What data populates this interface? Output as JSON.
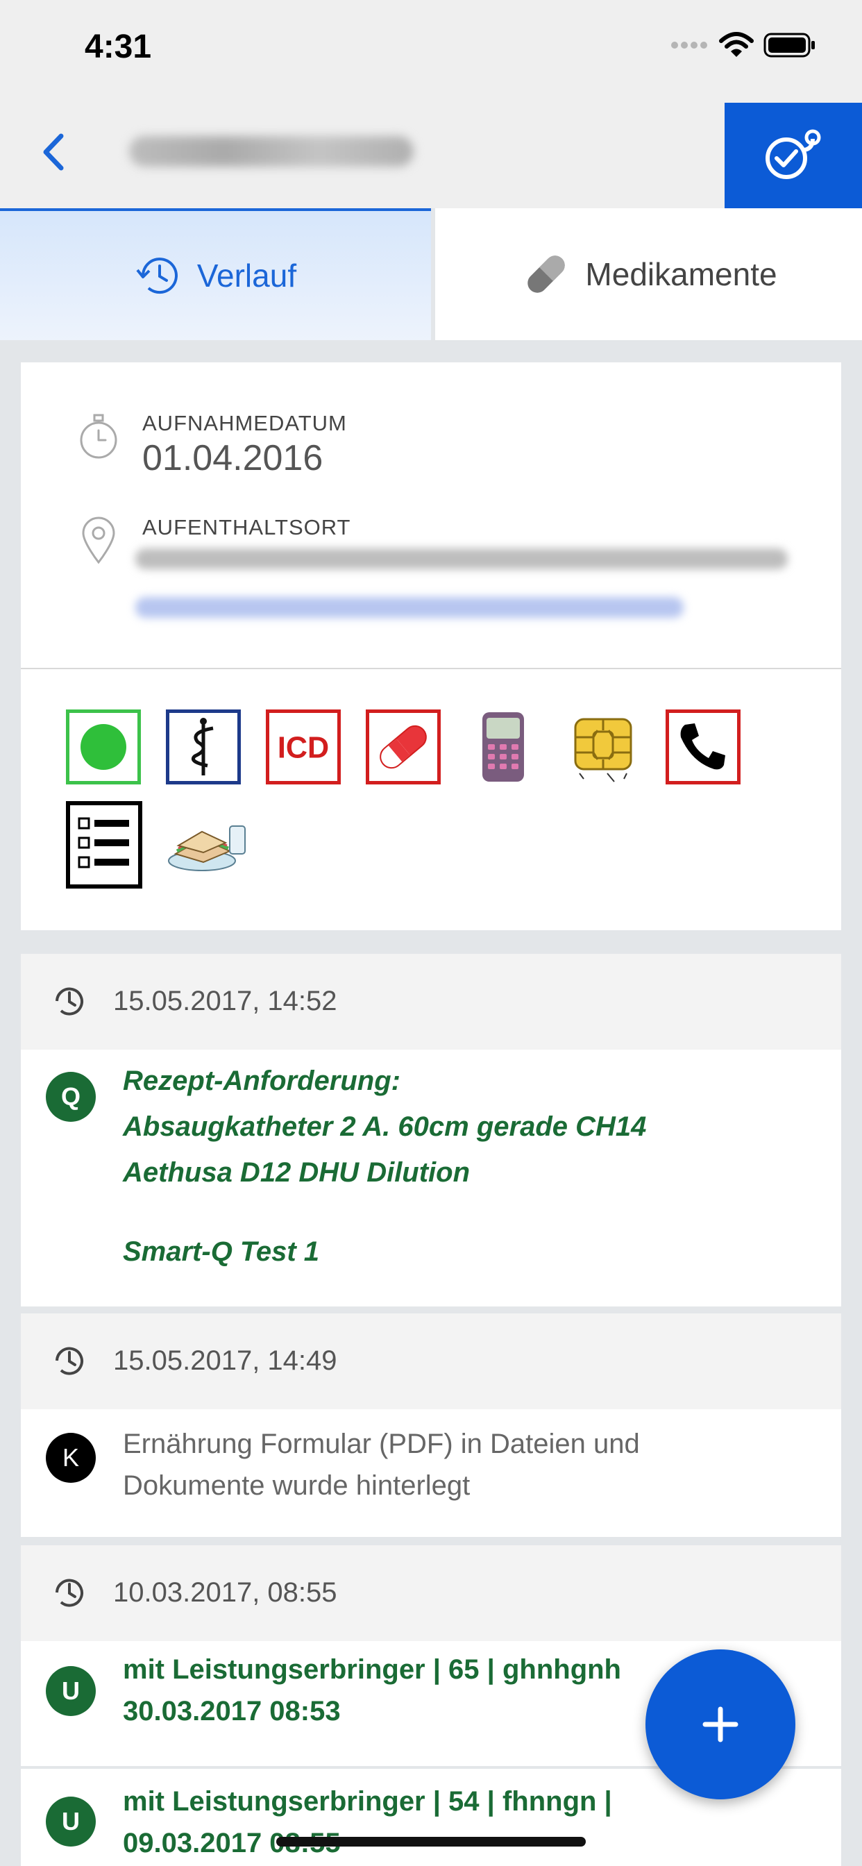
{
  "status_bar": {
    "time": "4:31"
  },
  "tabs": [
    {
      "label": "Verlauf",
      "icon": "history-icon",
      "active": true
    },
    {
      "label": "Medikamente",
      "icon": "pill-icon",
      "active": false
    }
  ],
  "info": {
    "admission_label": "AUFNAHMEDATUM",
    "admission_date": "01.04.2016",
    "location_label": "AUFENTHALTSORT"
  },
  "quick_icons": [
    "status-green-icon",
    "medical-caduceus-icon",
    "icd-icon",
    "medication-pill-icon",
    "infusion-pump-icon",
    "chip-card-icon",
    "phone-icon",
    "checklist-icon",
    "meal-icon"
  ],
  "timeline": [
    {
      "timestamp": "15.05.2017, 14:52",
      "entries": [
        {
          "badge": "Q",
          "badge_color": "#1a6b35",
          "lines": [
            "Rezept-Anforderung:",
            "Absaugkatheter 2 A. 60cm gerade CH14",
            "Aethusa D12 DHU Dilution",
            "Smart-Q Test 1"
          ]
        }
      ]
    },
    {
      "timestamp": "15.05.2017, 14:49",
      "entries": [
        {
          "badge": "K",
          "badge_color": "#000000",
          "lines": [
            "Ernährung Formular (PDF) in Dateien und",
            "Dokumente wurde hinterlegt"
          ]
        }
      ]
    },
    {
      "timestamp": "10.03.2017, 08:55",
      "entries": [
        {
          "badge": "U",
          "badge_color": "#1a6b35",
          "lines": [
            "mit Leistungserbringer | 65 | ghnhgnh",
            "30.03.2017 08:53"
          ]
        },
        {
          "badge": "U",
          "badge_color": "#1a6b35",
          "lines": [
            "mit Leistungserbringer | 54 | fhnngn |",
            "09.03.2017 08:55"
          ]
        }
      ]
    }
  ],
  "colors": {
    "primary": "#0c5bd6",
    "green": "#1a6b35",
    "tab_active": "#1b66d8"
  },
  "fab_icon": "plus-icon"
}
